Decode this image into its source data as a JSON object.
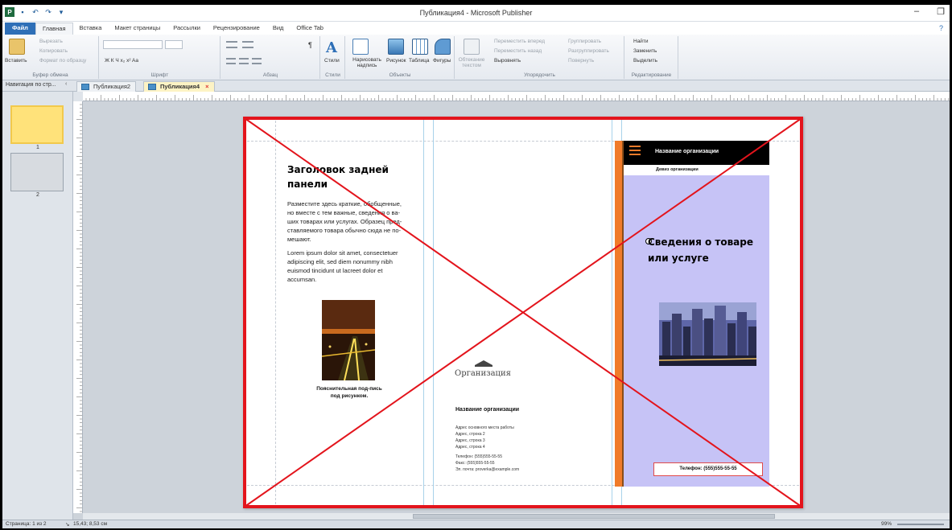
{
  "window": {
    "title": "Публикация4 - Microsoft Publisher",
    "minimize": "–",
    "restore": "❐"
  },
  "ribbon_tabs": [
    {
      "label": "Файл"
    },
    {
      "label": "Главная"
    },
    {
      "label": "Вставка"
    },
    {
      "label": "Макет страницы"
    },
    {
      "label": "Рассылки"
    },
    {
      "label": "Рецензирование"
    },
    {
      "label": "Вид"
    },
    {
      "label": "Office Tab"
    }
  ],
  "ribbon": {
    "clipboard": {
      "paste": "Вставить",
      "cut": "Вырезать",
      "copy": "Копировать",
      "format_painter": "Формат по образцу",
      "label": "Буфер обмена"
    },
    "font": {
      "label": "Шрифт",
      "formatting": "Ж  К  Ч  x₂  x²  Aa"
    },
    "paragraph": {
      "label": "Абзац"
    },
    "styles": {
      "button": "Стили",
      "label": "Стили"
    },
    "objects": {
      "draw_textbox": "Нарисовать надпись",
      "picture": "Рисунок",
      "table": "Таблица",
      "shapes": "Фигуры",
      "label": "Объекты"
    },
    "arrange": {
      "wrap_text": "Обтекание текстом",
      "bring_forward": "Переместить вперед",
      "send_backward": "Переместить назад",
      "align": "Выровнять",
      "group": "Группировать",
      "ungroup": "Разгруппировать",
      "rotate": "Повернуть",
      "label": "Упорядочить"
    },
    "editing": {
      "find": "Найти",
      "replace": "Заменить",
      "select": "Выделить",
      "label": "Редактирование"
    }
  },
  "navigation": {
    "title": "Навигация по стр...",
    "pages": [
      {
        "number": "1",
        "selected": true
      },
      {
        "number": "2",
        "selected": false
      }
    ]
  },
  "doc_tabs": [
    {
      "label": "Публикация2",
      "active": false
    },
    {
      "label": "Публикация4",
      "active": true
    }
  ],
  "publication": {
    "back_panel": {
      "heading": "Заголовок задней панели",
      "para1": "Разместите здесь краткие, обобщенные, но вместе с тем важные, сведения о ва-ших товарах или услугах. Образец пред-ставляемого товара обычно сюда не по-мешают.",
      "para2": "Lorem ipsum dolor sit amet, consectetuer adipiscing elit, sed diem nonummy nibh euismod tincidunt ut lacreet dolor et accumsan.",
      "caption": "Пояснительная под-пись под рисунком."
    },
    "middle_panel": {
      "logo_text": "Организация",
      "org_name": "Название организации",
      "address": [
        "Адрес основного места работы",
        "Адрес, строка 2",
        "Адрес, строка 3",
        "Адрес, строка 4"
      ],
      "contacts": [
        "Телефон: (555)555-55-55",
        "Факс: (555)555-55-55",
        "Эл. почта: proverka@example.com"
      ]
    },
    "front_panel": {
      "org_name": "Название организации",
      "motto": "Девиз организации",
      "heading": "Сведения о товаре или услуге",
      "phone": "Телефон: (555)555-55-55"
    }
  },
  "status": {
    "page": "Страница: 1 из 2",
    "position": "15,43; 8,53 см",
    "zoom": "99%"
  },
  "colors": {
    "accent_orange": "#f07b2a",
    "front_panel_bg": "#c6c3f6",
    "annotation_red": "#e3141c",
    "file_tab": "#2e6fb7"
  }
}
